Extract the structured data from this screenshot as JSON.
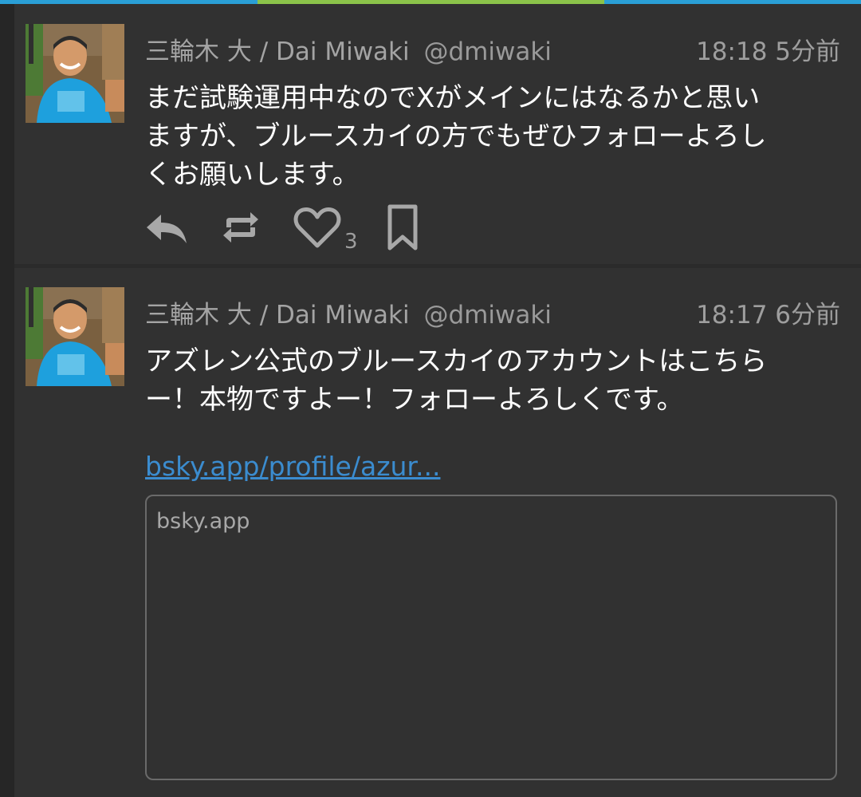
{
  "posts": [
    {
      "display_name": "三輪木 大 / Dai Miwaki",
      "handle": "@dmiwaki",
      "time": "18:18 5分前",
      "text_lines": [
        "まだ試験運用中なのでXがメインにはなるかと思い",
        "ますが、ブルースカイの方でもぜひフォローよろし",
        "くお願いします。"
      ],
      "like_count": "3",
      "icons": [
        "reply-icon",
        "repost-icon",
        "heart-icon",
        "bookmark-icon"
      ]
    },
    {
      "display_name": "三輪木 大 / Dai Miwaki",
      "handle": "@dmiwaki",
      "time": "18:17 6分前",
      "text_lines": [
        "アズレン公式のブルースカイのアカウントはこちら",
        "ー！本物ですよー！フォローよろしくです。"
      ],
      "link": "bsky.app/profile/azur...",
      "card": {
        "site": "bsky.app"
      }
    }
  ],
  "colors": {
    "accent_blue": "#2a9fd6",
    "accent_green": "#8bc34a",
    "link": "#3b8ccf",
    "background": "#313131"
  }
}
